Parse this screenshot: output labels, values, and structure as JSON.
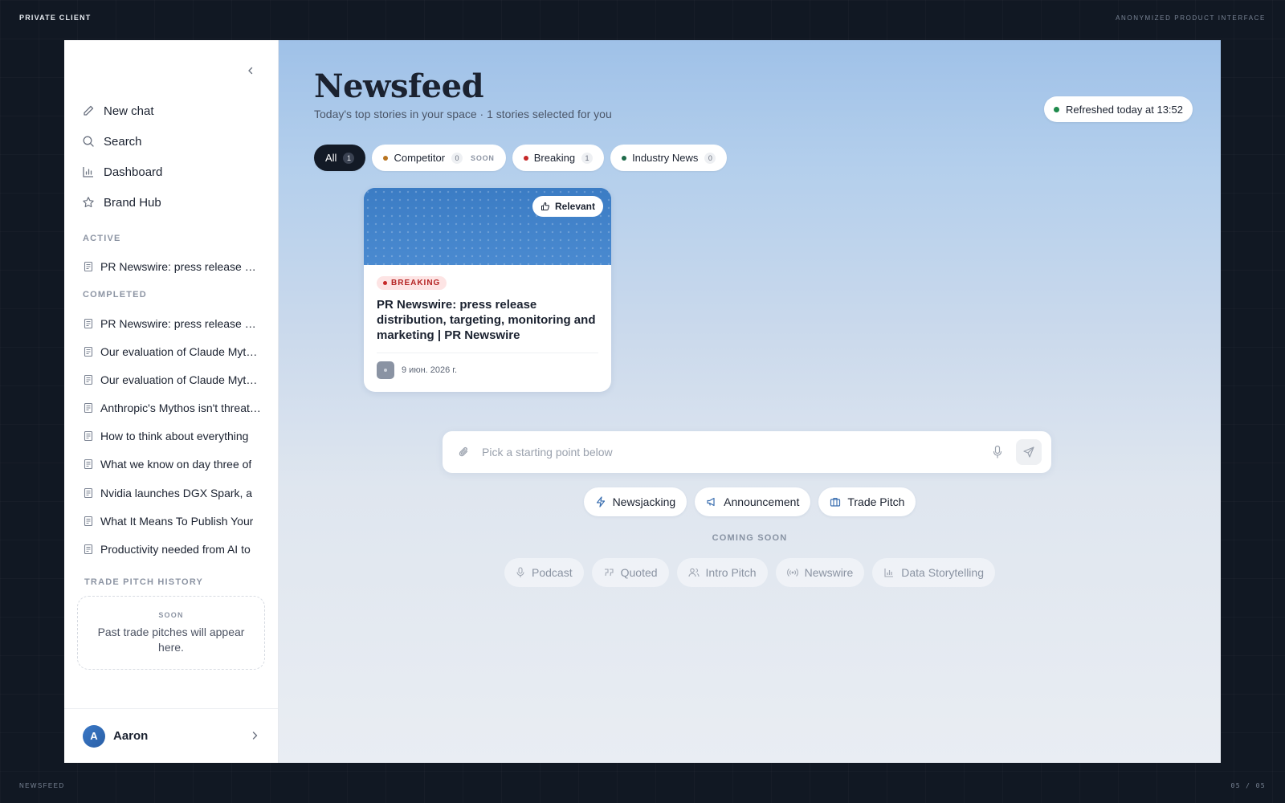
{
  "frame": {
    "top_left": "PRIVATE CLIENT",
    "top_right": "ANONYMIZED PRODUCT INTERFACE",
    "bottom_left": "NEWSFEED",
    "bottom_right": "05 / 05"
  },
  "sidebar": {
    "nav": [
      {
        "label": "New chat",
        "icon": "pencil-icon"
      },
      {
        "label": "Search",
        "icon": "search-icon"
      },
      {
        "label": "Dashboard",
        "icon": "bar-chart-icon"
      },
      {
        "label": "Brand Hub",
        "icon": "star-icon"
      }
    ],
    "active_label": "ACTIVE",
    "active_items": [
      "PR Newswire: press release distribution, targeting, monitoring and marketing | PR Newswire"
    ],
    "completed_label": "COMPLETED",
    "completed_items": [
      "PR Newswire: press release distribution, targeting, monitoring and marketing",
      "Our evaluation of Claude Mythos",
      "Our evaluation of Claude Mythos",
      "Anthropic's Mythos isn't threatening",
      "How to think about everything",
      "What we know on day three of",
      "Nvidia launches DGX Spark, a",
      "What It Means To Publish Your",
      "Productivity needed from AI to"
    ],
    "history_label": "TRADE PITCH HISTORY",
    "history_soon": "SOON",
    "history_message": "Past trade pitches will appear here.",
    "user": {
      "initial": "A",
      "name": "Aaron"
    }
  },
  "main": {
    "title": "Newsfeed",
    "subtitle": "Today's top stories in your space · 1 stories selected for you",
    "refreshed": "Refreshed today at 13:52",
    "filters": [
      {
        "label": "All",
        "count": "1",
        "active": true,
        "dot": ""
      },
      {
        "label": "Competitor",
        "count": "0",
        "soon": "SOON",
        "dot": "#b8741f"
      },
      {
        "label": "Breaking",
        "count": "1",
        "dot": "#c62828"
      },
      {
        "label": "Industry News",
        "count": "0",
        "dot": "#1f6b4a"
      }
    ],
    "card": {
      "relevant": "Relevant",
      "badge": "BREAKING",
      "title": "PR Newswire: press release distribution, targeting, monitoring and marketing | PR Newswire",
      "date": "9 июн. 2026 г."
    },
    "composer": {
      "placeholder": "Pick a starting point below"
    },
    "actions": [
      "Newsjacking",
      "Announcement",
      "Trade Pitch"
    ],
    "coming_soon_label": "COMING SOON",
    "coming_soon": [
      "Podcast",
      "Quoted",
      "Intro Pitch",
      "Newswire",
      "Data Storytelling"
    ]
  }
}
